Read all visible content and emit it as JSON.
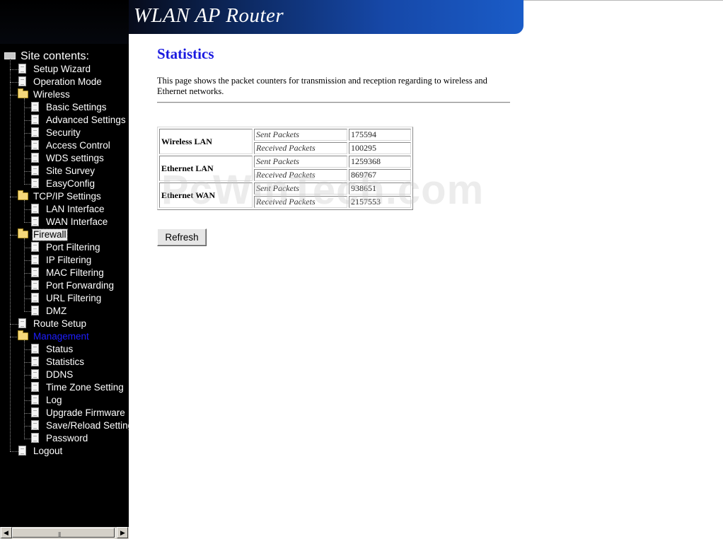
{
  "header": {
    "title": "WLAN AP Router"
  },
  "sidebar": {
    "root_label": "Site contents:",
    "items": [
      {
        "label": "Setup Wizard",
        "level": 1,
        "icon": "doc"
      },
      {
        "label": "Operation Mode",
        "level": 1,
        "icon": "doc"
      },
      {
        "label": "Wireless",
        "level": 1,
        "icon": "folder"
      },
      {
        "label": "Basic Settings",
        "level": 2,
        "icon": "doc"
      },
      {
        "label": "Advanced Settings",
        "level": 2,
        "icon": "doc"
      },
      {
        "label": "Security",
        "level": 2,
        "icon": "doc"
      },
      {
        "label": "Access Control",
        "level": 2,
        "icon": "doc"
      },
      {
        "label": "WDS settings",
        "level": 2,
        "icon": "doc"
      },
      {
        "label": "Site Survey",
        "level": 2,
        "icon": "doc"
      },
      {
        "label": "EasyConfig",
        "level": 2,
        "icon": "doc"
      },
      {
        "label": "TCP/IP Settings",
        "level": 1,
        "icon": "folder"
      },
      {
        "label": "LAN Interface",
        "level": 2,
        "icon": "doc"
      },
      {
        "label": "WAN Interface",
        "level": 2,
        "icon": "doc"
      },
      {
        "label": "Firewall",
        "level": 1,
        "icon": "folder",
        "state": "selected"
      },
      {
        "label": "Port Filtering",
        "level": 2,
        "icon": "doc"
      },
      {
        "label": "IP Filtering",
        "level": 2,
        "icon": "doc"
      },
      {
        "label": "MAC Filtering",
        "level": 2,
        "icon": "doc"
      },
      {
        "label": "Port Forwarding",
        "level": 2,
        "icon": "doc"
      },
      {
        "label": "URL Filtering",
        "level": 2,
        "icon": "doc"
      },
      {
        "label": "DMZ",
        "level": 2,
        "icon": "doc"
      },
      {
        "label": "Route Setup",
        "level": 1,
        "icon": "doc"
      },
      {
        "label": "Management",
        "level": 1,
        "icon": "folder",
        "state": "highlight"
      },
      {
        "label": "Status",
        "level": 2,
        "icon": "doc"
      },
      {
        "label": "Statistics",
        "level": 2,
        "icon": "doc"
      },
      {
        "label": "DDNS",
        "level": 2,
        "icon": "doc"
      },
      {
        "label": "Time Zone Setting",
        "level": 2,
        "icon": "doc"
      },
      {
        "label": "Log",
        "level": 2,
        "icon": "doc"
      },
      {
        "label": "Upgrade Firmware",
        "level": 2,
        "icon": "doc"
      },
      {
        "label": "Save/Reload Settings",
        "level": 2,
        "icon": "doc"
      },
      {
        "label": "Password",
        "level": 2,
        "icon": "doc"
      },
      {
        "label": "Logout",
        "level": 1,
        "icon": "doc"
      }
    ],
    "scrollbar": {
      "left_arrow": "◀",
      "right_arrow": "▶",
      "grip": "|||"
    }
  },
  "main": {
    "title": "Statistics",
    "description": "This page shows the packet counters for transmission and reception regarding to wireless and Ethernet networks.",
    "groups": [
      {
        "name": "Wireless LAN",
        "sent_label": "Sent Packets",
        "sent": "175594",
        "recv_label": "Received Packets",
        "recv": "100295"
      },
      {
        "name": "Ethernet LAN",
        "sent_label": "Sent Packets",
        "sent": "1259368",
        "recv_label": "Received Packets",
        "recv": "869767"
      },
      {
        "name": "Ethernet WAN",
        "sent_label": "Sent Packets",
        "sent": "938651",
        "recv_label": "Received Packets",
        "recv": "2157553"
      }
    ],
    "refresh_label": "Refresh"
  },
  "watermark": "PcWinTech.com",
  "colors": {
    "title_blue": "#1a1ae0",
    "banner_blue": "#1648a8",
    "sidebar_bg": "#000000",
    "highlight_blue": "#1e1eff"
  }
}
